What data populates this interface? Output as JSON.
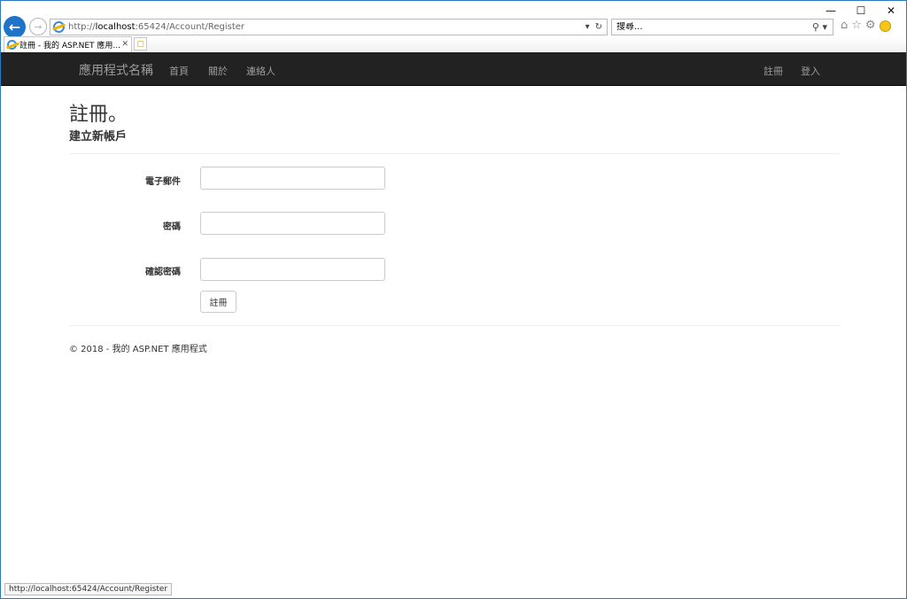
{
  "window": {
    "minimize_glyph": "—",
    "maximize_glyph": "☐",
    "close_glyph": "✕"
  },
  "browser": {
    "back_glyph": "←",
    "forward_glyph": "→",
    "address": {
      "url_prefix": "http://",
      "url_host": "localhost",
      "url_rest": ":65424/Account/Register",
      "dropdown_glyph": "▾",
      "refresh_glyph": "↻"
    },
    "search": {
      "placeholder": "搜尋...",
      "search_glyph": "⚲",
      "dropdown_glyph": "▾"
    },
    "tools": {
      "home_glyph": "⌂",
      "favorites_glyph": "☆",
      "settings_glyph": "⚙"
    },
    "tab": {
      "title": "註冊 - 我的 ASP.NET 應用...",
      "close_glyph": "✕"
    },
    "new_tab_glyph": "▢",
    "status_url": "http://localhost:65424/Account/Register"
  },
  "site": {
    "brand": "應用程式名稱",
    "nav_left": [
      "首頁",
      "關於",
      "連絡人"
    ],
    "nav_right": [
      "註冊",
      "登入"
    ]
  },
  "page": {
    "title": "註冊。",
    "subtitle": "建立新帳戶",
    "fields": [
      {
        "label": "電子郵件",
        "value": ""
      },
      {
        "label": "密碼",
        "value": ""
      },
      {
        "label": "確認密碼",
        "value": ""
      }
    ],
    "submit_label": "註冊",
    "footer": "© 2018 - 我的 ASP.NET 應用程式"
  },
  "colors": {
    "navbar_bg": "#222222",
    "nav_text": "#9d9d9d",
    "browser_accent": "#1e74c7"
  }
}
